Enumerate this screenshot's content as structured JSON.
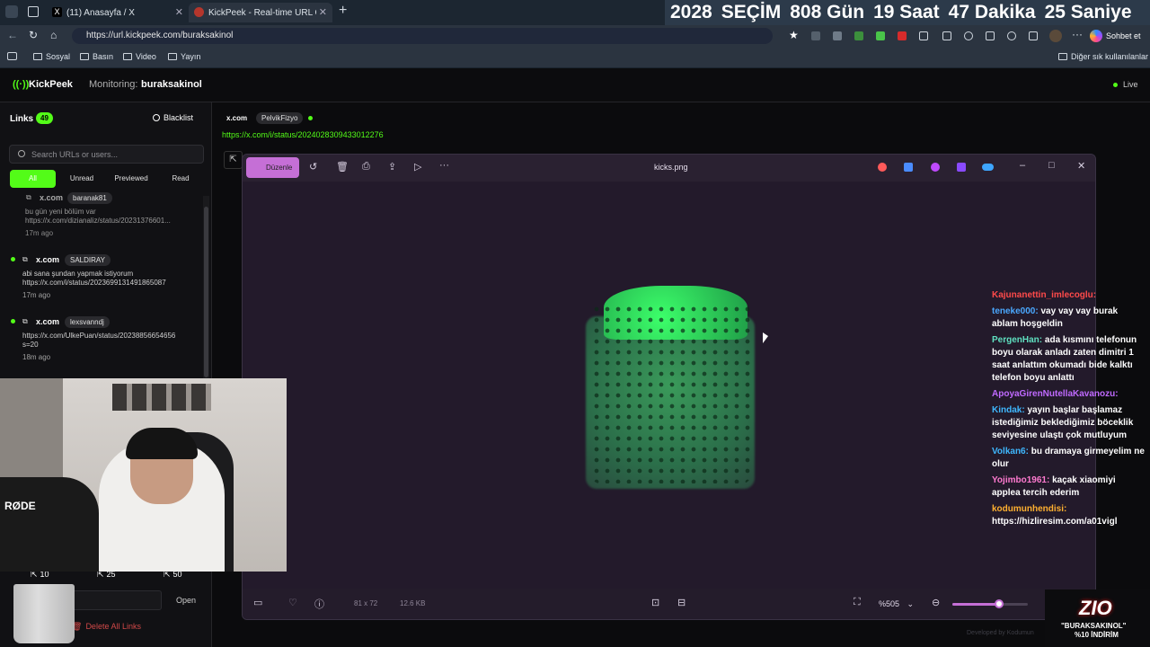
{
  "browser": {
    "tabs": [
      {
        "label": "(11) Anasayfa / X"
      },
      {
        "label": "KickPeek - Real-time URL Crawler"
      }
    ],
    "url": "https://url.kickpeek.com/buraksakinol",
    "profile_button": "Sohbet et",
    "bookmarks": [
      "Sosyal",
      "Basın",
      "Video",
      "Yayın"
    ],
    "other_bookmarks": "Diğer sık kullanılanlar"
  },
  "countdown": {
    "year": "2028",
    "label": "SEÇİM",
    "days": "808 Gün",
    "hours": "19 Saat",
    "minutes": "47 Dakika",
    "seconds": "25 Saniye"
  },
  "app": {
    "name": "KickPeek",
    "monitoring_label": "Monitoring:",
    "monitoring_user": "buraksakinol",
    "live_label": "Live"
  },
  "sidebar": {
    "links_label": "Links",
    "links_count": "49",
    "blacklist_label": "Blacklist",
    "search_placeholder": "Search URLs or users...",
    "filters": [
      "All",
      "Unread",
      "Previewed",
      "Read"
    ],
    "items": [
      {
        "domain": "x.com",
        "user": "baranak81",
        "text": "bu gün yeni bölüm var",
        "url": "https://x.com/dizianaliz/status/20231376601...",
        "time": "17m ago"
      },
      {
        "domain": "x.com",
        "user": "SALDIRAY",
        "text": "abi sana şundan yapmak istiyorum",
        "url": "https://x.com/i/status/2023699131491865087",
        "time": "17m ago"
      },
      {
        "domain": "x.com",
        "user": "lexsvanndj",
        "text": "",
        "url": "https://x.com/UlkePuan/status/20238856654656",
        "url2": "s=20",
        "time": "18m ago"
      }
    ],
    "stats": [
      {
        "value": "10"
      },
      {
        "value": "25"
      },
      {
        "value": "50"
      }
    ],
    "open_label": "Open",
    "delete_label": "Delete All Links"
  },
  "main": {
    "domain": "x.com",
    "user": "PelvikFizyo",
    "url": "https://x.com/i/status/2024028309433012276"
  },
  "viewer": {
    "edit_label": "Düzenle",
    "filename": "kicks.png",
    "dimensions": "81 x 72",
    "filesize": "12.6 KB",
    "zoom": "%505",
    "zoom_level": 0.62
  },
  "chat": [
    {
      "user": "Kajunanettin_imlecoglu:",
      "msg": "",
      "color": "#ff4a4a"
    },
    {
      "user": "teneke000:",
      "msg": "vay vay vay burak ablam hoşgeldin",
      "color": "#4aa8ff"
    },
    {
      "user": "PergenHan:",
      "msg": "ada kısmını telefonun boyu olarak anladı zaten dimitri 1 saat anlattım okumadı bide kalktı telefon boyu anlattı",
      "color": "#5fe0c0"
    },
    {
      "user": "ApoyaGirenNutellaKavanozu:",
      "msg": "",
      "color": "#c06aff"
    },
    {
      "user": "Kindak:",
      "msg": "yayın başlar başlamaz istediğimiz beklediğimiz böcek­lik seviyesine ulaştı çok mutluyum",
      "color": "#3fb8ff"
    },
    {
      "user": "Volkan6:",
      "msg": "bu dramaya girmeyelim ne olur",
      "color": "#3fb8ff"
    },
    {
      "user": "Yojimbo1961:",
      "msg": "kaçak xiaomiyi applea tercih ederim",
      "color": "#ff7ad0"
    },
    {
      "user": "kodumunhendisi:",
      "msg": "https://hizliresim.com/a01vigl",
      "color": "#ffb030"
    }
  ],
  "overlay": {
    "promo_line1": "\"BURAKSAKINOL\"",
    "promo_line2": "%10 İNDİRİM",
    "footer": "Developed by Kodumun"
  },
  "colors": {
    "accent": "#53fc18",
    "edit_button": "#c56fd6"
  }
}
